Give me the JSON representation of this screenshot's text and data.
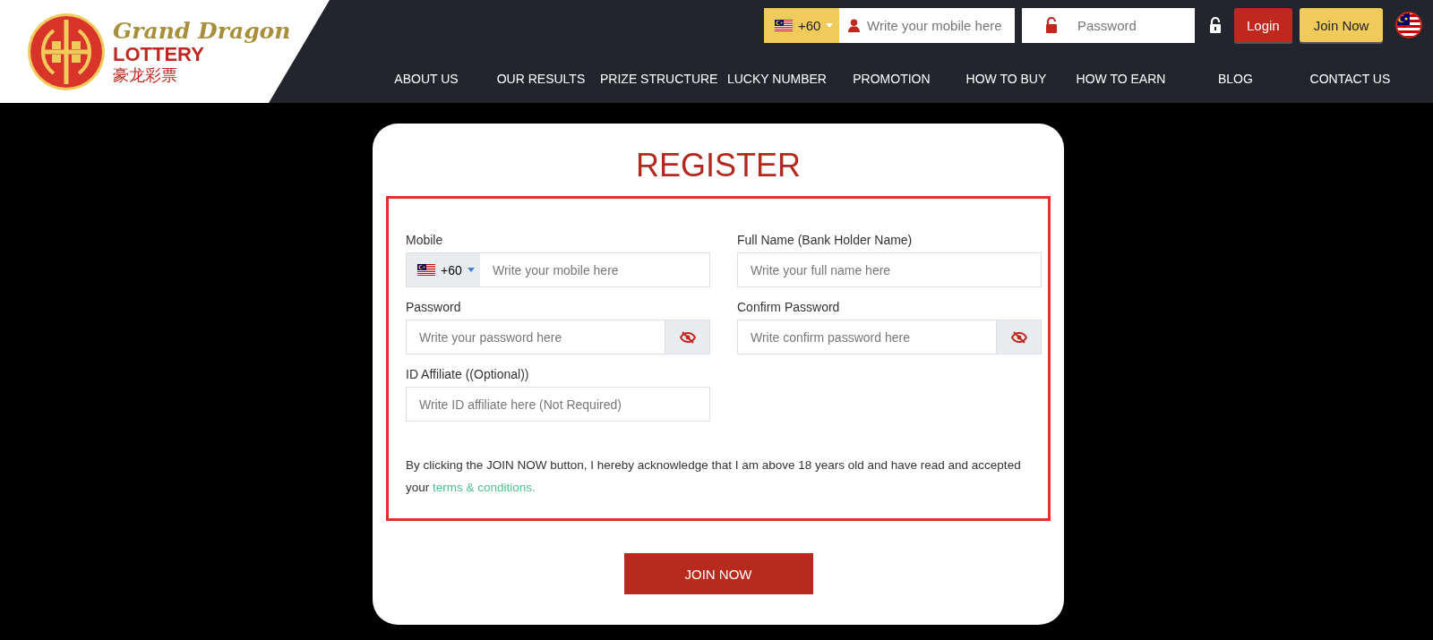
{
  "header": {
    "logo": {
      "title": "Grand Dragon",
      "subtitle": "LOTTERY",
      "chinese": "豪龙彩票"
    },
    "login_bar": {
      "country_code": "+60",
      "mobile_placeholder": "Write your mobile here",
      "password_placeholder": "Password",
      "login_button": "Login",
      "join_button": "Join Now"
    },
    "nav": [
      "ABOUT US",
      "OUR RESULTS",
      "PRIZE STRUCTURE",
      "LUCKY NUMBER",
      "PROMOTION",
      "HOW TO BUY",
      "HOW TO EARN",
      "BLOG",
      "CONTACT US"
    ]
  },
  "register": {
    "title": "REGISTER",
    "fields": [
      {
        "kind": "phone",
        "label": "Mobile",
        "prefix": "+60",
        "placeholder": "Write your mobile here"
      },
      {
        "kind": "text",
        "label": "Full Name (Bank Holder Name)",
        "placeholder": "Write your full name here"
      },
      {
        "kind": "password",
        "label": "Password",
        "placeholder": "Write your password here"
      },
      {
        "kind": "password",
        "label": "Confirm Password",
        "placeholder": "Write confirm password here"
      },
      {
        "kind": "text",
        "label": "ID Affiliate ((Optional))",
        "placeholder": "Write ID affiliate here (Not Required)"
      }
    ],
    "notice": "By clicking the JOIN NOW button, I hereby acknowledge that I am above 18 years old and have read and accepted your",
    "terms_link": "terms & conditions.",
    "submit": "JOIN NOW"
  }
}
